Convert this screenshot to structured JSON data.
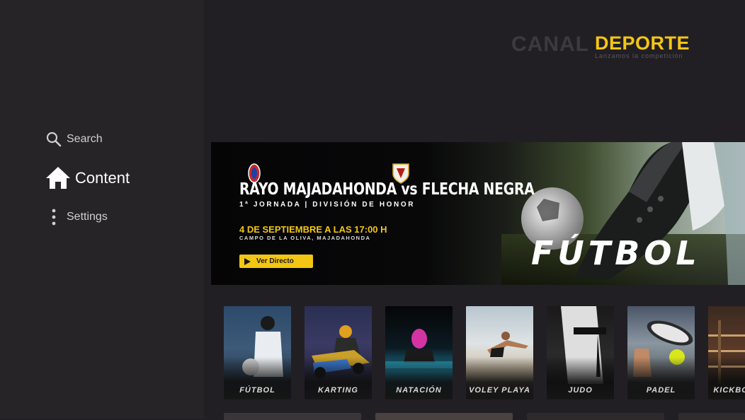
{
  "sidebar": {
    "items": [
      {
        "label": "Search",
        "icon": "search-icon"
      },
      {
        "label": "Content",
        "icon": "home-icon"
      },
      {
        "label": "Settings",
        "icon": "more-vertical-icon"
      }
    ]
  },
  "logo": {
    "canal": "CANAL",
    "deporte": "DEPORTE",
    "tagline": "Lanzamos la competición",
    "colors": {
      "accent": "#f3c614",
      "muted": "#3b3a3e"
    }
  },
  "banner": {
    "title": "RAYO MAJADAHONDA vs FLECHA NEGRA",
    "subtitle": "1ª JORNADA | DIVISIÓN DE HONOR",
    "date": "4 DE SEPTIEMBRE A LAS 17:00 H",
    "venue": "CAMPO DE LA OLIVA, MAJADAHONDA",
    "button_label": "Ver Directo",
    "big_text": "FÚTBOL"
  },
  "categories": [
    {
      "label": "FÚTBOL"
    },
    {
      "label": "KARTING"
    },
    {
      "label": "NATACIÓN"
    },
    {
      "label": "VOLEY PLAYA"
    },
    {
      "label": "JUDO"
    },
    {
      "label": "PADEL"
    },
    {
      "label": "KICKBOXING"
    }
  ]
}
